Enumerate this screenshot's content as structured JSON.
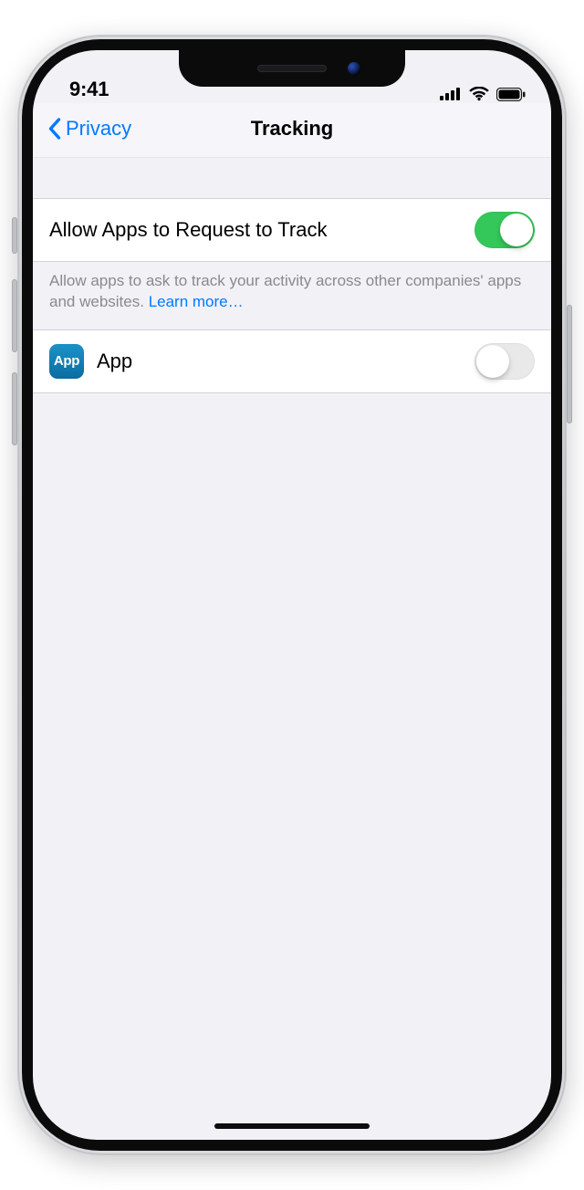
{
  "status": {
    "time": "9:41"
  },
  "nav": {
    "back_label": "Privacy",
    "title": "Tracking"
  },
  "settings": {
    "allow_request": {
      "label": "Allow Apps to Request to Track",
      "on": true
    },
    "footer_text": "Allow apps to ask to track your activity across other companies' apps and websites. ",
    "learn_more": "Learn more…"
  },
  "apps": [
    {
      "name": "App",
      "icon_text": "App",
      "on": false
    }
  ],
  "colors": {
    "accent": "#007aff",
    "switch_on": "#34c759"
  }
}
